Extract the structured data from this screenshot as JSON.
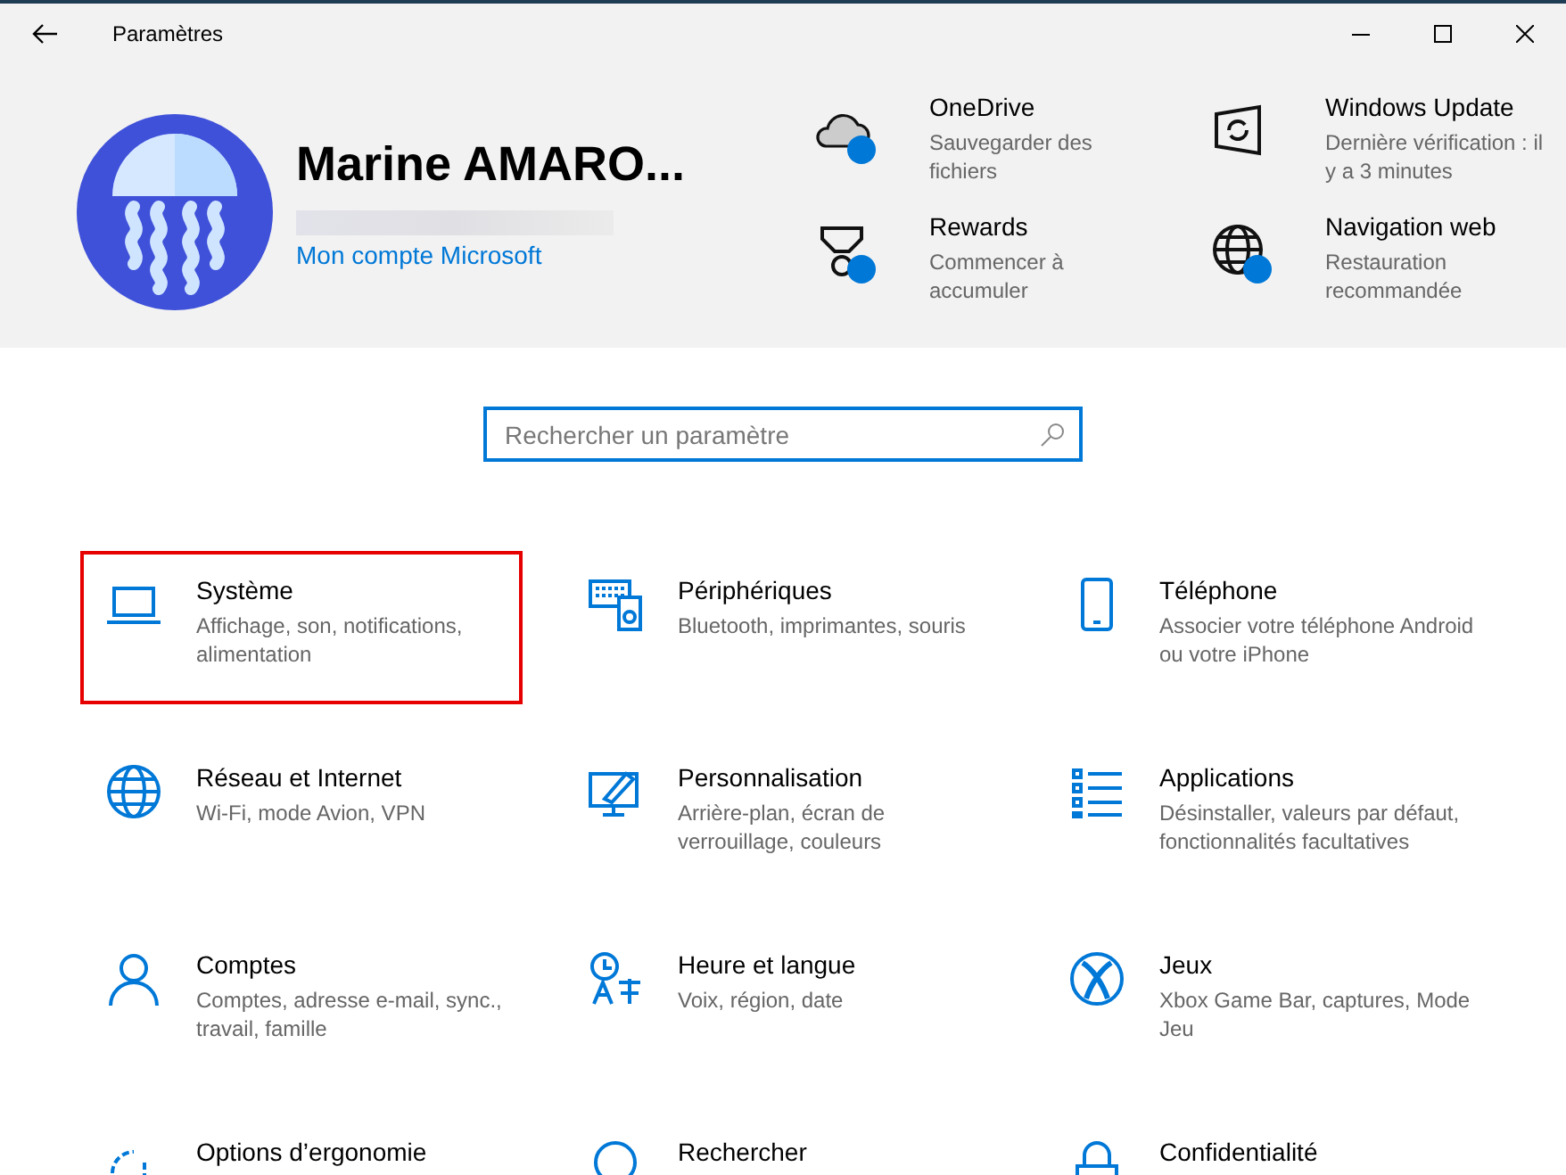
{
  "window": {
    "title": "Paramètres"
  },
  "account": {
    "name": "Marine AMARO...",
    "link": "Mon compte Microsoft"
  },
  "quick_links": [
    {
      "title": "OneDrive",
      "subtitle": "Sauvegarder des fichiers",
      "badge": true
    },
    {
      "title": "Windows Update",
      "subtitle": "Dernière vérification : il y a 3 minutes",
      "badge": false
    },
    {
      "title": "Rewards",
      "subtitle": "Commencer à accumuler",
      "badge": true
    },
    {
      "title": "Navigation web",
      "subtitle": "Restauration recommandée",
      "badge": true
    }
  ],
  "search": {
    "placeholder": "Rechercher un paramètre"
  },
  "categories": [
    {
      "title": "Système",
      "subtitle": "Affichage, son, notifications, alimentation",
      "highlighted": true
    },
    {
      "title": "Périphériques",
      "subtitle": "Bluetooth, imprimantes, souris",
      "highlighted": false
    },
    {
      "title": "Téléphone",
      "subtitle": "Associer votre téléphone Android ou votre iPhone",
      "highlighted": false
    },
    {
      "title": "Réseau et Internet",
      "subtitle": "Wi-Fi, mode Avion, VPN",
      "highlighted": false
    },
    {
      "title": "Personnalisation",
      "subtitle": "Arrière-plan, écran de verrouillage, couleurs",
      "highlighted": false
    },
    {
      "title": "Applications",
      "subtitle": "Désinstaller, valeurs par défaut, fonctionnalités facultatives",
      "highlighted": false
    },
    {
      "title": "Comptes",
      "subtitle": "Comptes, adresse e-mail, sync., travail, famille",
      "highlighted": false
    },
    {
      "title": "Heure et langue",
      "subtitle": "Voix, région, date",
      "highlighted": false
    },
    {
      "title": "Jeux",
      "subtitle": "Xbox Game Bar, captures, Mode Jeu",
      "highlighted": false
    },
    {
      "title": "Options d’ergonomie",
      "highlighted": false
    },
    {
      "title": "Rechercher",
      "highlighted": false
    },
    {
      "title": "Confidentialité",
      "highlighted": false
    }
  ]
}
